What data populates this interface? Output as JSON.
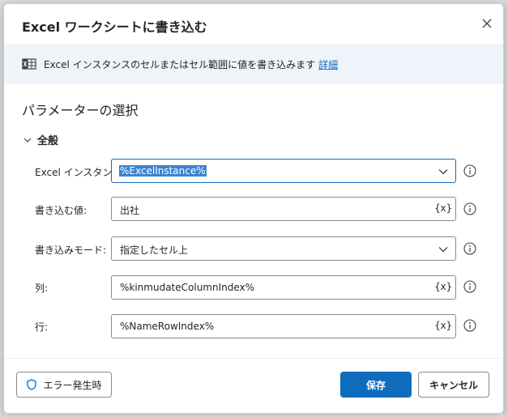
{
  "dialog": {
    "title": "Excel ワークシートに書き込む",
    "close_icon": "close-icon"
  },
  "info": {
    "icon": "excel-grid-icon",
    "text": "Excel インスタンスのセルまたはセル範囲に値を書き込みます",
    "link": "詳細"
  },
  "section": {
    "title": "パラメーターの選択"
  },
  "group": {
    "label": "全般",
    "expanded": true
  },
  "fields": {
    "excel_instance": {
      "label": "Excel インスタンス:",
      "value": "%ExcelInstance%",
      "type": "dropdown"
    },
    "write_value": {
      "label": "書き込む値:",
      "value": "出社",
      "var_button": "{x}"
    },
    "write_mode": {
      "label": "書き込みモード:",
      "value": "指定したセル上",
      "type": "dropdown"
    },
    "column": {
      "label": "列:",
      "value": "%kinmudateColumnIndex%",
      "var_button": "{x}"
    },
    "row": {
      "label": "行:",
      "value": "%NameRowIndex%",
      "var_button": "{x}"
    }
  },
  "footer": {
    "error_button": "エラー発生時",
    "save_button": "保存",
    "cancel_button": "キャンセル"
  },
  "colors": {
    "accent": "#0f6cbd",
    "info_bg": "#eff4fa",
    "selection": "#3b84cf"
  }
}
